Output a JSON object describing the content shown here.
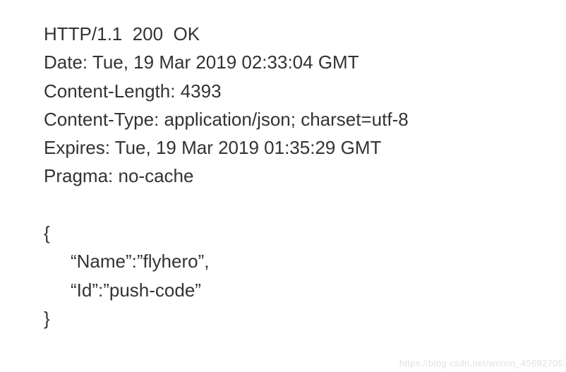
{
  "http_response": {
    "status_line": "HTTP/1.1  200  OK",
    "headers": {
      "date": "Date: Tue, 19 Mar 2019 02:33:04 GMT",
      "content_length": "Content-Length: 4393",
      "content_type": "Content-Type: application/json; charset=utf-8",
      "expires": "Expires: Tue, 19 Mar 2019 01:35:29 GMT",
      "pragma": "Pragma: no-cache"
    },
    "body": {
      "open_brace": "{",
      "name_line": "“Name”:”flyhero”,",
      "id_line": "“Id”:”push-code”",
      "close_brace": "}"
    }
  },
  "watermark": "https://blog.csdn.net/weixin_45692705"
}
